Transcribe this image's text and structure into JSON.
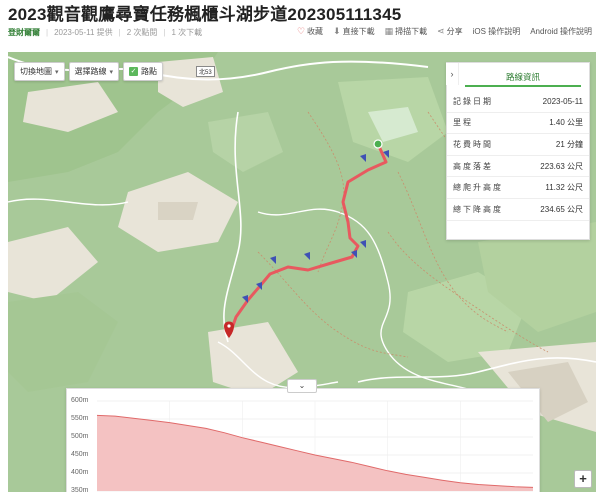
{
  "page": {
    "title": "2023觀音觀鷹尋寶任務楓櫃斗湖步道202305111345",
    "author": "登財爾爾",
    "date_provided": "2023-05-11 提供",
    "views": "2 次點閱",
    "downloads": "1 次下載"
  },
  "actions": [
    {
      "label": "收藏",
      "icon": "heart-icon"
    },
    {
      "label": "直接下載",
      "icon": "download-icon"
    },
    {
      "label": "掃描下載",
      "icon": "qrcode-icon"
    },
    {
      "label": "分享",
      "icon": "share-icon"
    },
    {
      "label": "iOS 操作說明",
      "icon": ""
    },
    {
      "label": "Android 操作說明",
      "icon": ""
    }
  ],
  "map_controls": {
    "switch_map": "切換地圖",
    "switch_route": "選擇路線",
    "waypoints": "路點"
  },
  "route_info": {
    "tab": "路線資訊",
    "rows": [
      {
        "label": "記錄日期",
        "value": "2023-05-11"
      },
      {
        "label": "里程",
        "value": "1.40 公里"
      },
      {
        "label": "花費時間",
        "value": "21 分鐘"
      },
      {
        "label": "高度落差",
        "value": "223.63 公尺"
      },
      {
        "label": "總爬升高度",
        "value": "11.32 公尺"
      },
      {
        "label": "總下降高度",
        "value": "234.65 公尺"
      }
    ]
  },
  "map_labels": {
    "road_shield": "北53",
    "zoom_in": "+"
  },
  "elevation": {
    "toggle": "⌄",
    "y_ticks": [
      "600m",
      "550m",
      "500m",
      "450m",
      "400m",
      "350m"
    ],
    "profile": [
      560,
      558,
      552,
      546,
      540,
      532,
      524,
      512,
      498,
      486,
      474,
      462,
      450,
      440,
      430,
      418,
      406,
      396,
      388,
      380,
      373,
      368,
      365,
      362,
      360
    ],
    "ylim": [
      350,
      600
    ],
    "colors": {
      "fill": "#f4c2c2",
      "line": "#e06a6a",
      "route": "#e8595f"
    }
  }
}
